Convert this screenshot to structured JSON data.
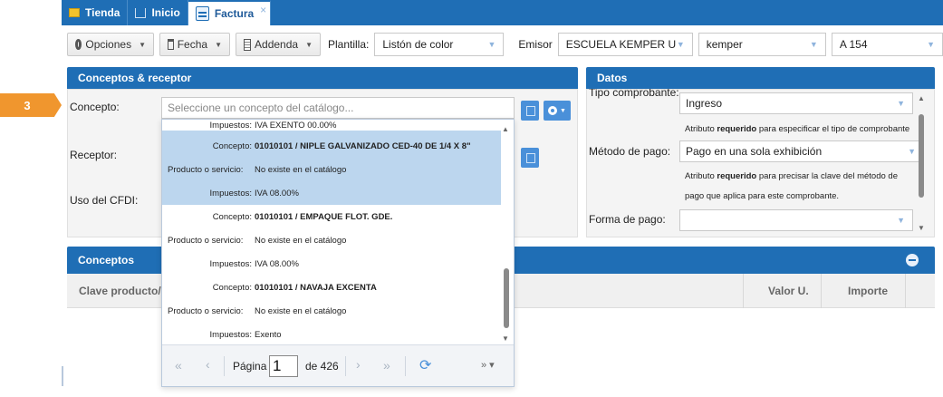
{
  "tabs": [
    {
      "label": "Tienda",
      "icon": "store-icon"
    },
    {
      "label": "Inicio",
      "icon": "home-icon"
    },
    {
      "label": "Factura",
      "icon": "document-icon",
      "active": true,
      "close": "×"
    }
  ],
  "toolbar": {
    "opciones": "Opciones",
    "fecha": "Fecha",
    "addenda": "Addenda",
    "plantilla_label": "Plantilla:",
    "plantilla_value": "Listón de color",
    "emisor_label": "Emisor",
    "emisor_value": "ESCUELA KEMPER U",
    "sucursal_value": "kemper",
    "serie_value": "A 154"
  },
  "step": {
    "number": "3"
  },
  "conceptos_receptor": {
    "title": "Conceptos & receptor",
    "concepto_label": "Concepto:",
    "concepto_placeholder": "Seleccione un concepto del catálogo...",
    "receptor_label": "Receptor:",
    "uso_cfdi_label": "Uso del CFDI:"
  },
  "datos": {
    "title": "Datos",
    "tipo_label": "Tipo comprobante:",
    "tipo_value": "Ingreso",
    "tipo_help_pre": "Atributo ",
    "tipo_help_bold": "requerido",
    "tipo_help_post": " para especificar el tipo de comprobante",
    "metodo_label": "Método de pago:",
    "metodo_value": "Pago en una sola exhibición",
    "metodo_help_pre": "Atributo ",
    "metodo_help_bold": "requerido",
    "metodo_help_post": " para precisar la clave del método de",
    "metodo_help_line2": "pago que aplica para este comprobante.",
    "forma_label": "Forma de pago:",
    "forma_value": ""
  },
  "conceptos": {
    "title": "Conceptos",
    "columns": [
      "Clave producto/s",
      "Valor U.",
      "Importe"
    ]
  },
  "dropdown": {
    "rows": [
      {
        "key": "Impuestos:",
        "value": "IVA EXENTO 00.00%",
        "bold": false,
        "indent": true
      },
      {
        "key": "Concepto:",
        "value": "01010101 / NIPLE GALVANIZADO CED-40 DE 1/4 X 8\"",
        "bold": true,
        "indent": true,
        "selected": true
      },
      {
        "key": "Producto o servicio:",
        "value": "No existe en el catálogo",
        "bold": false,
        "indent": false,
        "selected": true
      },
      {
        "key": "Impuestos:",
        "value": "IVA 08.00%",
        "bold": false,
        "indent": true,
        "selected": true
      },
      {
        "key": "Concepto:",
        "value": "01010101 / EMPAQUE FLOT. GDE.",
        "bold": true,
        "indent": true
      },
      {
        "key": "Producto o servicio:",
        "value": "No existe en el catálogo",
        "bold": false,
        "indent": false
      },
      {
        "key": "Impuestos:",
        "value": "IVA 08.00%",
        "bold": false,
        "indent": true
      },
      {
        "key": "Concepto:",
        "value": "01010101 / NAVAJA EXCENTA",
        "bold": true,
        "indent": true
      },
      {
        "key": "Producto o servicio:",
        "value": "No existe en el catálogo",
        "bold": false,
        "indent": false
      },
      {
        "key": "Impuestos:",
        "value": "Exento",
        "bold": false,
        "indent": true
      }
    ],
    "pager": {
      "first": "«",
      "prev": "‹",
      "page_label": "Página",
      "page_value": "1",
      "of_label": "de 426",
      "next": "›",
      "last": "»",
      "refresh": "⟳",
      "more": "» ▾"
    }
  },
  "colors": {
    "primary": "#1f6eb5",
    "accent": "#f0962e",
    "selected": "#bcd6ee"
  }
}
